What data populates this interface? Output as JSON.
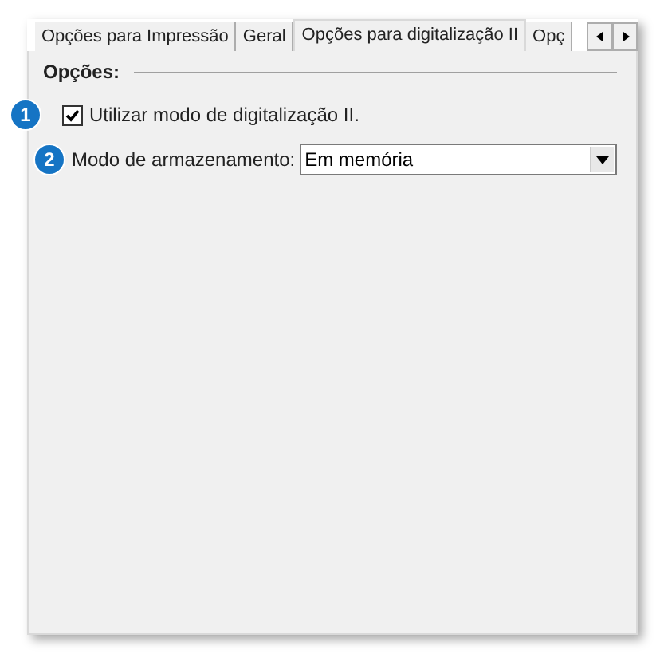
{
  "tabs": [
    {
      "label": "Opções para Impressão",
      "selected": false
    },
    {
      "label": "Geral",
      "selected": false
    },
    {
      "label": "Opções para digitalização II",
      "selected": true
    },
    {
      "label": "Opç",
      "selected": false
    }
  ],
  "group": {
    "title": "Opções:"
  },
  "options": [
    {
      "kind": "checkbox",
      "badge": "1",
      "label": "Utilizar modo de digitalização II.",
      "checked": true
    },
    {
      "kind": "dropdown",
      "badge": "2",
      "label": "Modo de armazenamento:",
      "value": "Em memória"
    }
  ]
}
